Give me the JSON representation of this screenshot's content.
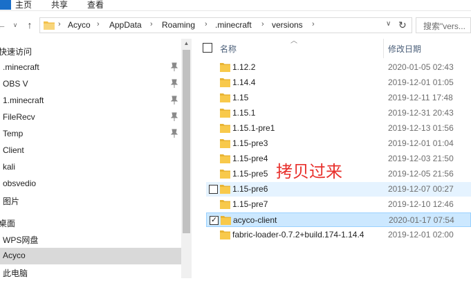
{
  "ribbon": {
    "tabs": [
      {
        "label": "主页"
      },
      {
        "label": "共享"
      },
      {
        "label": "查看"
      }
    ]
  },
  "address": {
    "crumbs": [
      "Acyco",
      "AppData",
      "Roaming",
      ".minecraft",
      "versions"
    ],
    "search_placeholder": "搜索\"vers..."
  },
  "nav_pane": {
    "quick_access_label": "快速访问",
    "quick_items": [
      {
        "label": ".minecraft",
        "pinned": true
      },
      {
        "label": "OBS V",
        "pinned": true
      },
      {
        "label": "1.minecraft",
        "pinned": true
      },
      {
        "label": "FileRecv",
        "pinned": true
      },
      {
        "label": "Temp",
        "pinned": true
      },
      {
        "label": "Client",
        "pinned": false
      },
      {
        "label": "kali",
        "pinned": false
      },
      {
        "label": "obsvedio",
        "pinned": false
      },
      {
        "label": "图片",
        "pinned": false
      }
    ],
    "desktop_label": "桌面",
    "desktop_items": [
      {
        "label": "WPS网盘"
      },
      {
        "label": "Acyco",
        "selected": true
      },
      {
        "label": "此电脑"
      }
    ]
  },
  "file_list": {
    "col_name": "名称",
    "col_date": "修改日期",
    "rows": [
      {
        "name": "1.12.2",
        "date": "2020-01-05 02:43"
      },
      {
        "name": "1.14.4",
        "date": "2019-12-01 01:05"
      },
      {
        "name": "1.15",
        "date": "2019-12-11 17:48"
      },
      {
        "name": "1.15.1",
        "date": "2019-12-31 20:43"
      },
      {
        "name": "1.15.1-pre1",
        "date": "2019-12-13 01:56"
      },
      {
        "name": "1.15-pre3",
        "date": "2019-12-01 01:04"
      },
      {
        "name": "1.15-pre4",
        "date": "2019-12-03 21:50"
      },
      {
        "name": "1.15-pre5",
        "date": "2019-12-05 21:56"
      },
      {
        "name": "1.15-pre6",
        "date": "2019-12-07 00:27"
      },
      {
        "name": "1.15-pre7",
        "date": "2019-12-10 12:46"
      },
      {
        "name": "acyco-client",
        "date": "2020-01-17 07:54"
      },
      {
        "name": "fabric-loader-0.7.2+build.174-1.14.4",
        "date": "2019-12-01 02:00"
      }
    ]
  },
  "annotation": "拷贝过来",
  "colors": {
    "selected_row": "#cce8ff",
    "hover_row": "#e5f3ff",
    "folder": "#f8c94b",
    "annotation": "#e8302c"
  }
}
